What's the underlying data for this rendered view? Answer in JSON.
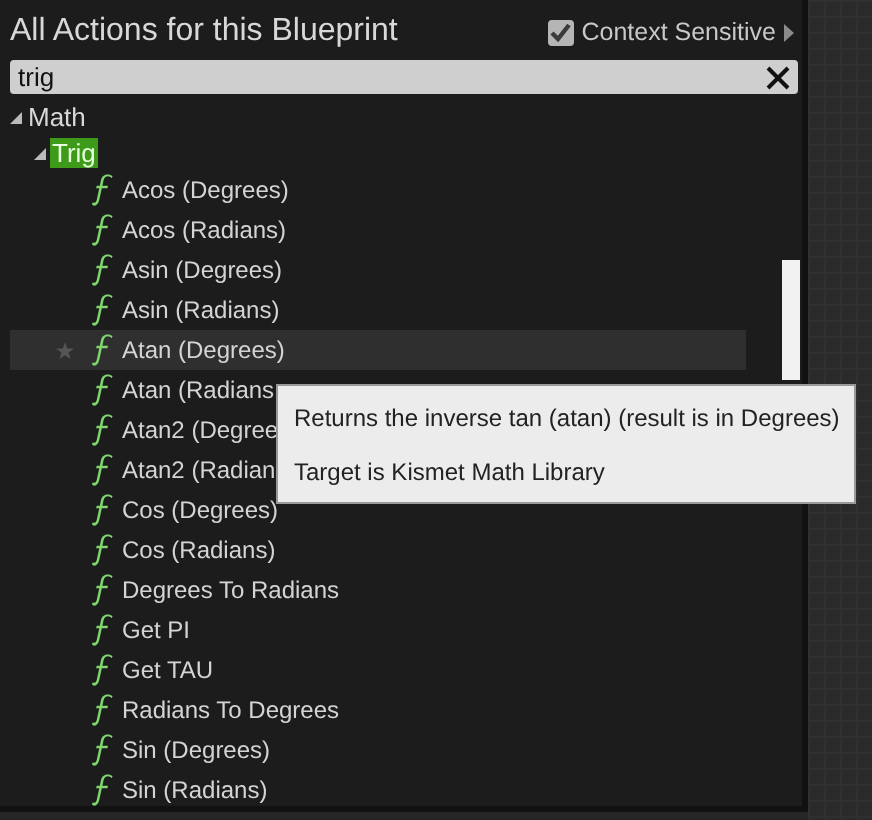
{
  "header": {
    "title": "All Actions for this Blueprint",
    "context_sensitive": {
      "label": "Context Sensitive",
      "checked": true
    }
  },
  "search": {
    "value": "trig"
  },
  "tree": [
    {
      "label": "Math",
      "expanded": true,
      "children": [
        {
          "label": "Trig",
          "expanded": true,
          "highlighted": true,
          "children": [
            {
              "label": "Acos (Degrees)",
              "hovered": false
            },
            {
              "label": "Acos (Radians)",
              "hovered": false
            },
            {
              "label": "Asin (Degrees)",
              "hovered": false
            },
            {
              "label": "Asin (Radians)",
              "hovered": false
            },
            {
              "label": "Atan (Degrees)",
              "hovered": true
            },
            {
              "label": "Atan (Radians",
              "hovered": false
            },
            {
              "label": "Atan2 (Degree",
              "hovered": false
            },
            {
              "label": "Atan2 (Radian",
              "hovered": false
            },
            {
              "label": "Cos (Degrees)",
              "hovered": false
            },
            {
              "label": "Cos (Radians)",
              "hovered": false
            },
            {
              "label": "Degrees To Radians",
              "hovered": false
            },
            {
              "label": "Get PI",
              "hovered": false
            },
            {
              "label": "Get TAU",
              "hovered": false
            },
            {
              "label": "Radians To Degrees",
              "hovered": false
            },
            {
              "label": "Sin (Degrees)",
              "hovered": false
            },
            {
              "label": "Sin (Radians)",
              "hovered": false
            }
          ]
        }
      ]
    }
  ],
  "tooltip": {
    "lines": [
      "Returns the inverse tan (atan) (result is in Degrees)",
      "Target is Kismet Math Library"
    ]
  }
}
